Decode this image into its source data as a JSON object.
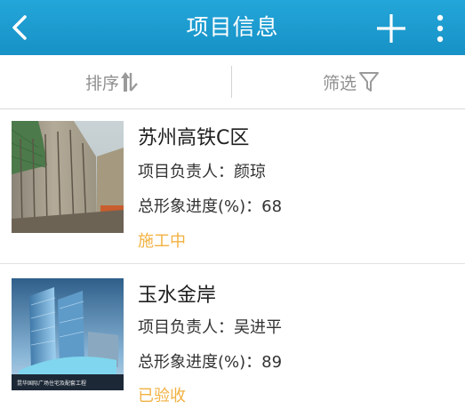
{
  "header": {
    "title": "项目信息",
    "back_icon": "chevron-left-icon",
    "add_icon": "plus-icon",
    "more_icon": "more-vertical-icon"
  },
  "filter_bar": {
    "sort_label": "排序",
    "sort_icon": "sort-arrows-icon",
    "filter_label": "筛选",
    "filter_icon": "funnel-icon"
  },
  "projects": [
    {
      "name": "苏州高铁C区",
      "manager_label": "项目负责人：",
      "manager": "颜琼",
      "progress_label": "总形象进度(%)：",
      "progress": "68",
      "status": "施工中",
      "image": "construction-site-photo"
    },
    {
      "name": "玉水金岸",
      "manager_label": "项目负责人：",
      "manager": "吴进平",
      "progress_label": "总形象进度(%)：",
      "progress": "89",
      "status": "已验收",
      "image": "building-rendering-photo",
      "image_caption": "昆华国际广场住宅及配套工程"
    }
  ],
  "colors": {
    "header_bg": "#1d9bd1",
    "status": "#f2b141",
    "muted_text": "#8f8f8f"
  }
}
